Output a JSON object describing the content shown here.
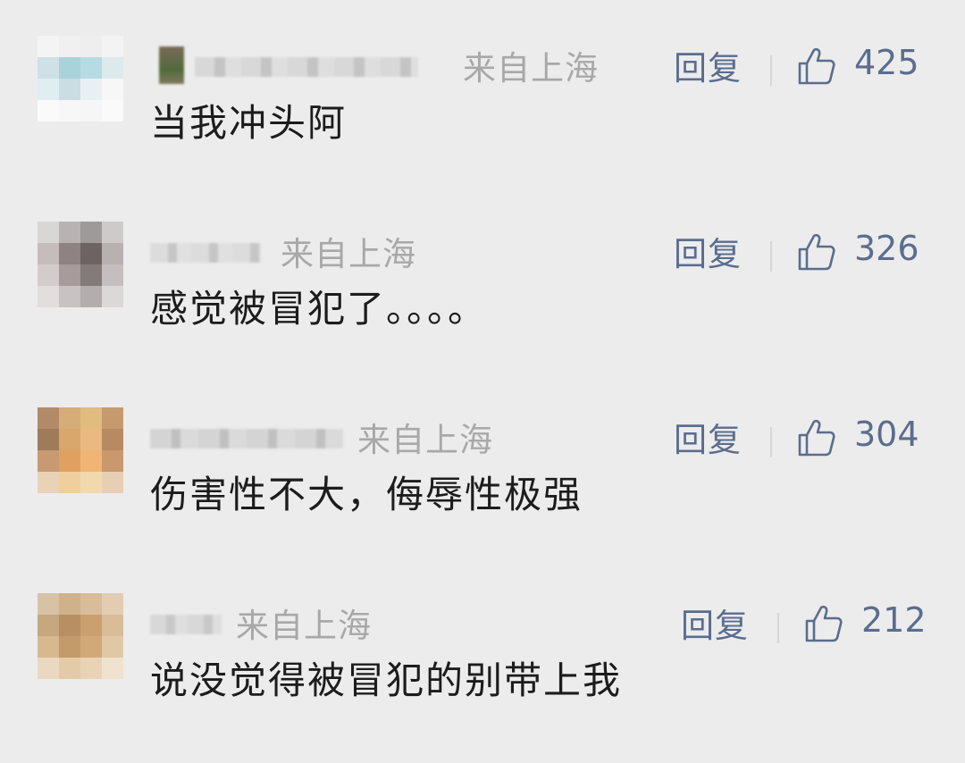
{
  "comments": [
    {
      "location": "来自上海",
      "reply_label": "回复",
      "likes": "425",
      "text": "当我冲头阿",
      "avatar_colors": [
        "#f4f4f4",
        "#f0f0f0",
        "#eeeeee",
        "#f3f3f3",
        "#cfe0e6",
        "#a9d2db",
        "#b7dbe2",
        "#dceaec",
        "#dfeef1",
        "#c9dde3",
        "#e9f0f2",
        "#f7f7f7",
        "#fafafa",
        "#f7f7f7",
        "#f6f6f6",
        "#fafafa"
      ]
    },
    {
      "location": "来自上海",
      "reply_label": "回复",
      "likes": "326",
      "text": "感觉被冒犯了。。。。",
      "avatar_colors": [
        "#d9d6d6",
        "#b8b2b2",
        "#9f9a9a",
        "#cfcaca",
        "#c6bcbc",
        "#8e8282",
        "#6e6363",
        "#b9b0b0",
        "#d4cccc",
        "#a79b9b",
        "#847a7a",
        "#c5bebe",
        "#e2dede",
        "#c8c2c2",
        "#b3adad",
        "#dcd8d8"
      ]
    },
    {
      "location": "来自上海",
      "reply_label": "回复",
      "likes": "304",
      "text": "伤害性不大，侮辱性极强",
      "avatar_colors": [
        "#b38a67",
        "#d6ac78",
        "#e2bb7f",
        "#c59a6f",
        "#9f7b5a",
        "#d9a76b",
        "#eab981",
        "#b78a62",
        "#c79a72",
        "#e0a05f",
        "#f0b575",
        "#c9986e",
        "#e9d2b7",
        "#efcf9d",
        "#f2d8ad",
        "#e6cfb4"
      ]
    },
    {
      "location": "来自上海",
      "reply_label": "回复",
      "likes": "212",
      "text": "说没觉得被冒犯的别带上我",
      "avatar_colors": [
        "#d7c2a6",
        "#cfb18a",
        "#d9bc98",
        "#e2cdb3",
        "#c7a77e",
        "#b88f62",
        "#caa06e",
        "#d9bc98",
        "#d8b98f",
        "#c39a6a",
        "#d1a978",
        "#e0c7a6",
        "#ead8c0",
        "#e3cba8",
        "#e8d3b5",
        "#efe2cf"
      ]
    }
  ]
}
